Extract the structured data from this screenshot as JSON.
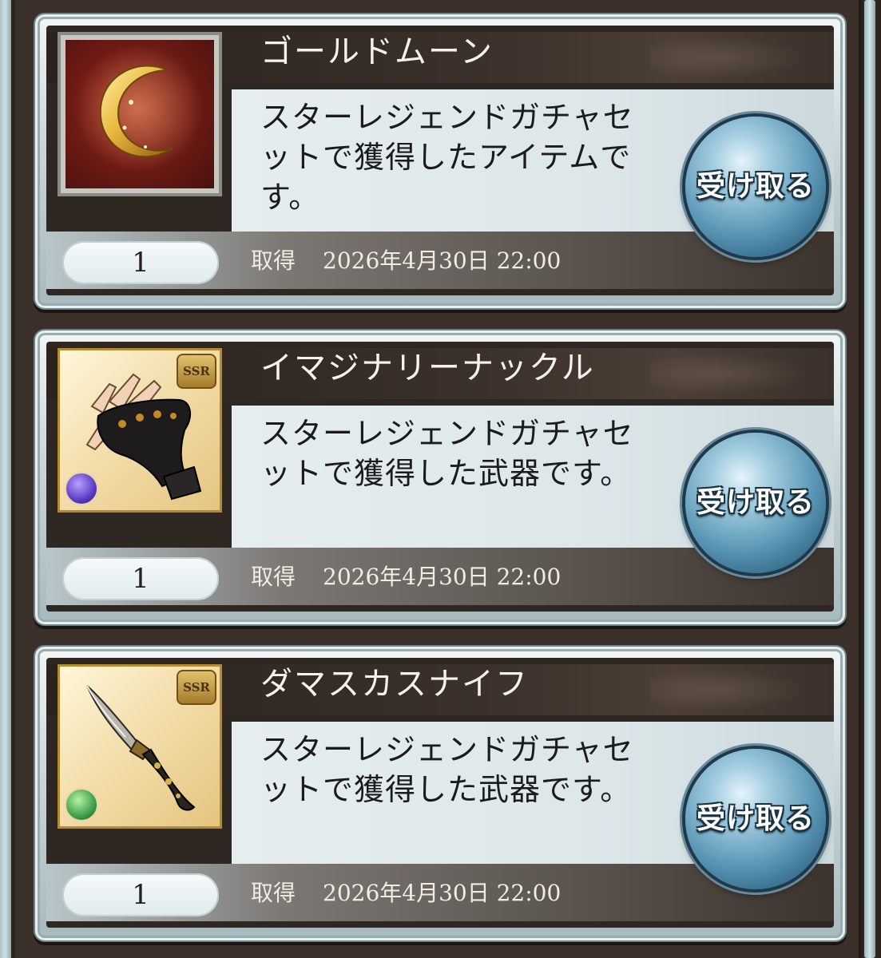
{
  "items": [
    {
      "name": "ゴールドムーン",
      "description": "スターレジェンドガチャセットで獲得したアイテムです。",
      "quantity": "1",
      "acquired_label": "取得",
      "acquired_date": "2026年4月30日 22:00",
      "claim_label": "受け取る",
      "icon": "gold-moon-icon",
      "rarity_badge": "",
      "element_icon": ""
    },
    {
      "name": "イマジナリーナックル",
      "description": "スターレジェンドガチャセットで獲得した武器です。",
      "quantity": "1",
      "acquired_label": "取得",
      "acquired_date": "2026年4月30日 22:00",
      "claim_label": "受け取る",
      "icon": "knuckle-glove-icon",
      "rarity_badge": "SSR",
      "element_icon": "dark-element-icon"
    },
    {
      "name": "ダマスカスナイフ",
      "description": "スターレジェンドガチャセットで獲得した武器です。",
      "quantity": "1",
      "acquired_label": "取得",
      "acquired_date": "2026年4月30日 22:00",
      "claim_label": "受け取る",
      "icon": "damascus-knife-icon",
      "rarity_badge": "SSR",
      "element_icon": "wind-element-icon"
    }
  ],
  "colors": {
    "claim_button": "#5e9ab8",
    "name_band": "#3b302a",
    "frame_gold": "#b48a33"
  }
}
